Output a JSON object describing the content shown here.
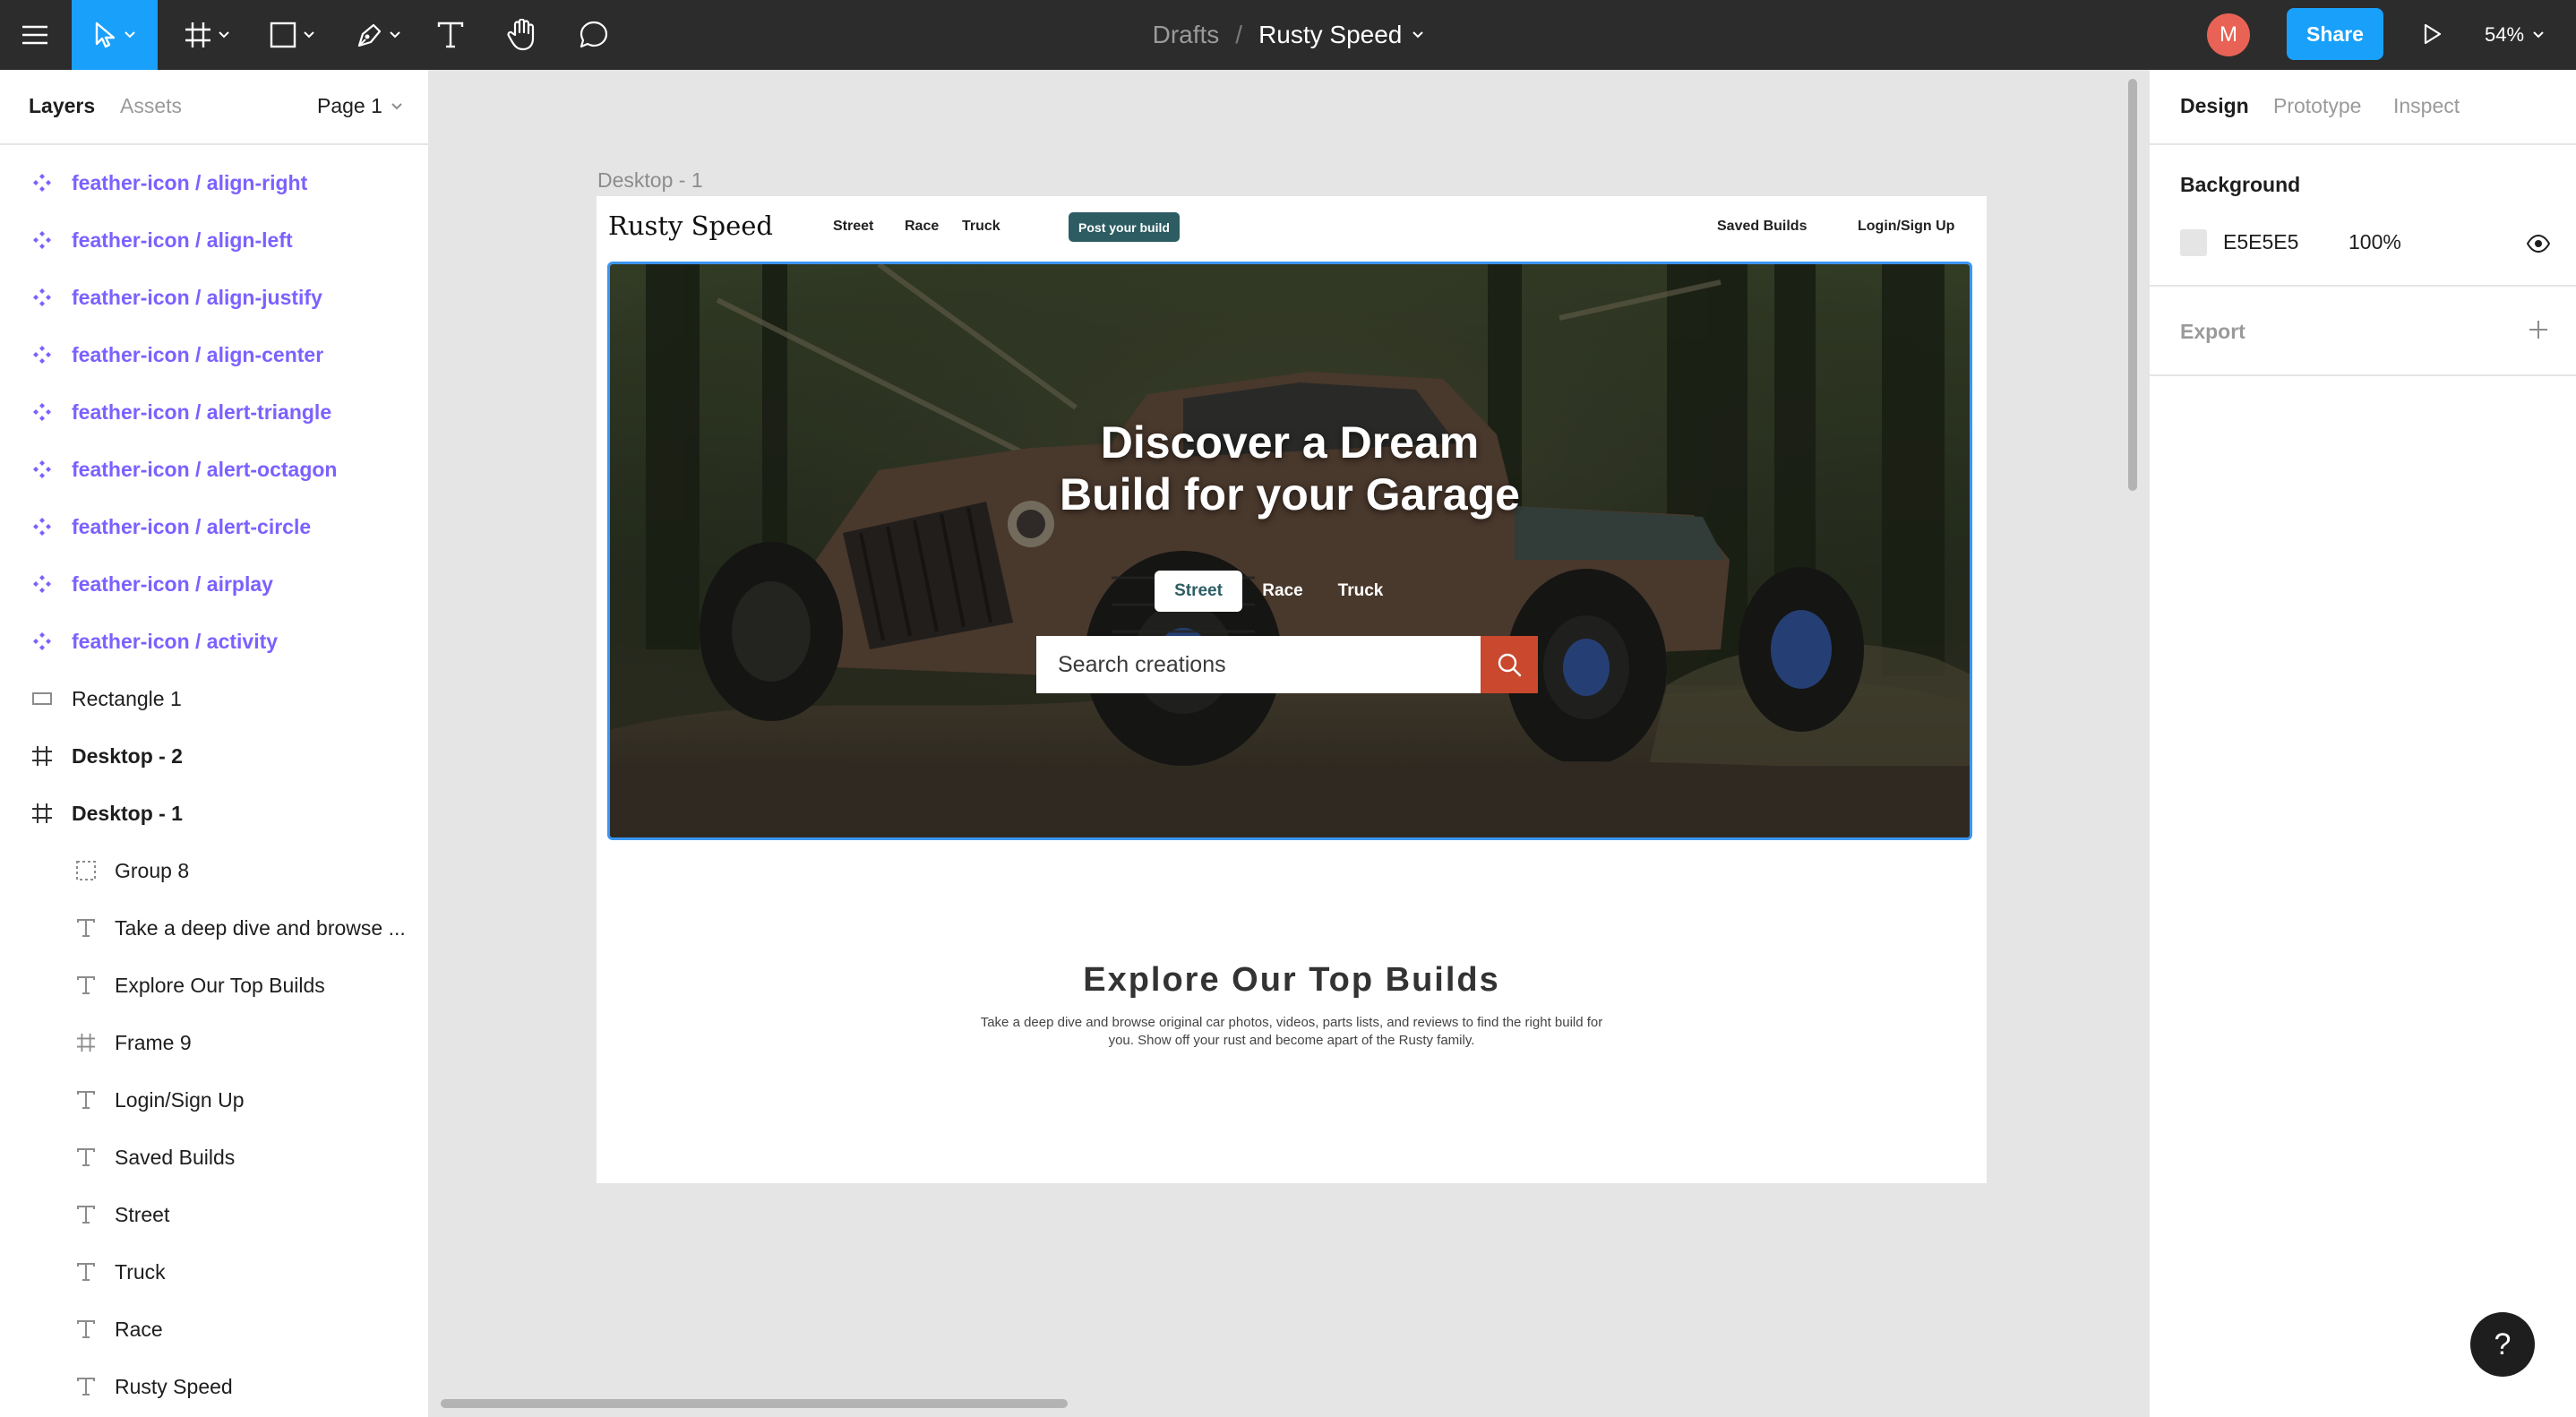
{
  "toolbar": {
    "breadcrumb_parent": "Drafts",
    "breadcrumb_separator": "/",
    "file_name": "Rusty Speed",
    "avatar_initial": "M",
    "share_label": "Share",
    "zoom_level": "54%",
    "tools": [
      "menu-icon",
      "move-icon",
      "frame-icon",
      "rectangle-icon",
      "pen-icon",
      "text-icon",
      "hand-icon",
      "comment-icon"
    ],
    "accent_color": "#18A0FB"
  },
  "left_panel": {
    "tabs": {
      "layers": "Layers",
      "assets": "Assets"
    },
    "page_selector": "Page 1",
    "layers": [
      {
        "name": "feather-icon / align-right",
        "type": "component"
      },
      {
        "name": "feather-icon / align-left",
        "type": "component"
      },
      {
        "name": "feather-icon / align-justify",
        "type": "component"
      },
      {
        "name": "feather-icon / align-center",
        "type": "component"
      },
      {
        "name": "feather-icon / alert-triangle",
        "type": "component"
      },
      {
        "name": "feather-icon / alert-octagon",
        "type": "component"
      },
      {
        "name": "feather-icon / alert-circle",
        "type": "component"
      },
      {
        "name": "feather-icon / airplay",
        "type": "component"
      },
      {
        "name": "feather-icon / activity",
        "type": "component"
      },
      {
        "name": "Rectangle 1",
        "type": "rectangle"
      },
      {
        "name": "Desktop - 2",
        "type": "frame"
      },
      {
        "name": "Desktop - 1",
        "type": "frame"
      },
      {
        "name": "Group 8",
        "type": "group"
      },
      {
        "name": "Take a deep dive and browse ...",
        "type": "text"
      },
      {
        "name": "Explore Our Top Builds",
        "type": "text"
      },
      {
        "name": "Frame 9",
        "type": "frame-child"
      },
      {
        "name": "Login/Sign Up",
        "type": "text"
      },
      {
        "name": "Saved Builds",
        "type": "text"
      },
      {
        "name": "Street",
        "type": "text"
      },
      {
        "name": "Truck",
        "type": "text"
      },
      {
        "name": "Race",
        "type": "text"
      },
      {
        "name": "Rusty Speed",
        "type": "text"
      }
    ]
  },
  "canvas": {
    "frame_label": "Desktop - 1",
    "site": {
      "logo": "Rusty Speed",
      "nav": {
        "street": "Street",
        "race": "Race",
        "truck": "Truck",
        "post_build": "Post your build",
        "saved_builds": "Saved Builds",
        "login": "Login/Sign Up"
      },
      "hero": {
        "title_line1": "Discover a Dream",
        "title_line2": "Build for your Garage",
        "tabs": {
          "street": "Street",
          "race": "Race",
          "truck": "Truck"
        },
        "search_placeholder": "Search creations"
      },
      "section_title": "Explore Our Top Builds",
      "section_body": "Take a deep dive and browse original car photos, videos, parts lists, and reviews to find the right build for you. Show off your rust and become apart of the Rusty family.",
      "brand_color": "#2D5D63",
      "search_button_color": "#C9482E"
    }
  },
  "right_panel": {
    "tabs": {
      "design": "Design",
      "prototype": "Prototype",
      "inspect": "Inspect"
    },
    "background_heading": "Background",
    "background_hex": "E5E5E5",
    "background_opacity": "100%",
    "export_heading": "Export"
  },
  "help_label": "?"
}
